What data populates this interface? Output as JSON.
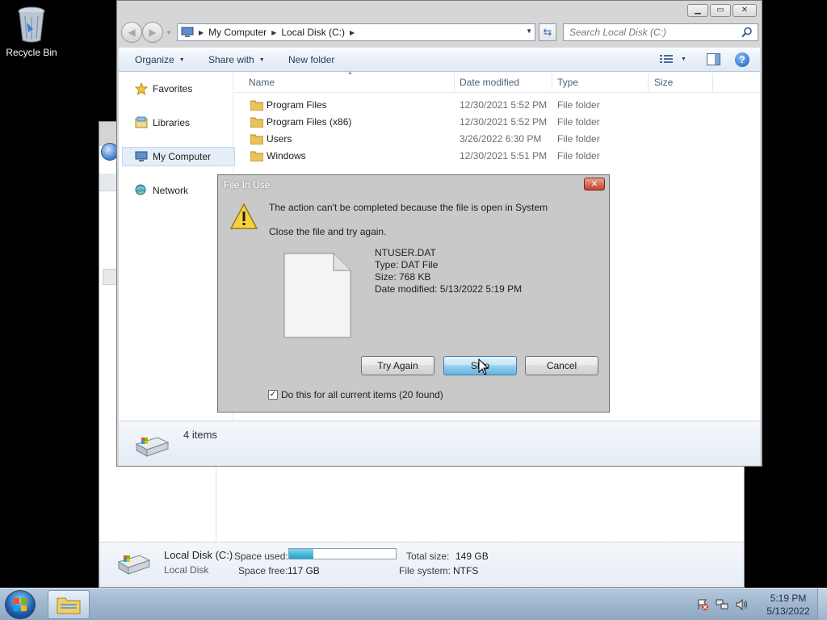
{
  "desktop": {
    "icons": [
      {
        "label": "Recycle Bin",
        "icon": "recycle-bin-icon"
      }
    ]
  },
  "explorer": {
    "address": {
      "crumbs": [
        "My Computer",
        "Local Disk (C:)"
      ]
    },
    "search": {
      "placeholder": "Search Local Disk (C:)"
    },
    "toolbar": {
      "organize": "Organize",
      "share_with": "Share with",
      "new_folder": "New folder"
    },
    "nav": {
      "favorites": "Favorites",
      "libraries": "Libraries",
      "my_computer": "My Computer",
      "network": "Network"
    },
    "columns": {
      "name": "Name",
      "date_modified": "Date modified",
      "type": "Type",
      "size": "Size"
    },
    "files": [
      {
        "name": "Program Files",
        "date": "12/30/2021 5:52 PM",
        "type": "File folder"
      },
      {
        "name": "Program Files (x86)",
        "date": "12/30/2021 5:52 PM",
        "type": "File folder"
      },
      {
        "name": "Users",
        "date": "3/26/2022 6:30 PM",
        "type": "File folder"
      },
      {
        "name": "Windows",
        "date": "12/30/2021 5:51 PM",
        "type": "File folder"
      }
    ],
    "status": {
      "item_count": "4 items"
    }
  },
  "back_window": {
    "details": {
      "name": "Local Disk (C:)",
      "type": "Local Disk",
      "space_used_label": "Space used:",
      "space_used_fraction": 0.23,
      "space_free_label": "Space free:",
      "space_free_value": "117 GB",
      "total_size_label": "Total size:",
      "total_size_value": "149 GB",
      "file_system_label": "File system:",
      "file_system_value": "NTFS"
    }
  },
  "dialog": {
    "title": "File In Use",
    "message": "The action can't be completed because the file is open in System",
    "instruction": "Close the file and try again.",
    "file": {
      "name": "NTUSER.DAT",
      "type": "Type: DAT File",
      "size": "Size: 768 KB",
      "date": "Date modified: 5/13/2022 5:19 PM"
    },
    "buttons": {
      "try_again": "Try Again",
      "skip": "Skip",
      "cancel": "Cancel"
    },
    "checkbox": {
      "label": "Do this for all current items (20 found)",
      "checked": true
    }
  },
  "taskbar": {
    "clock_time": "5:19 PM",
    "clock_date": "5/13/2022"
  }
}
